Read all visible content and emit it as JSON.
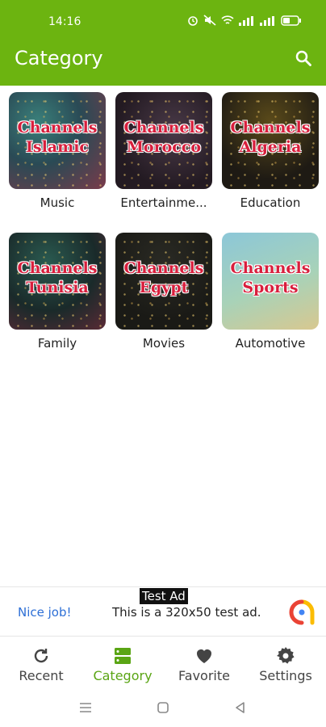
{
  "status_bar": {
    "time": "14:16"
  },
  "app_bar": {
    "title": "Category"
  },
  "categories": [
    {
      "label": "Music",
      "thumb_text_1": "Channels",
      "thumb_text_2": "Islamic"
    },
    {
      "label": "Entertainme...",
      "thumb_text_1": "Channels",
      "thumb_text_2": "Morocco"
    },
    {
      "label": "Education",
      "thumb_text_1": "Channels",
      "thumb_text_2": "Algeria"
    },
    {
      "label": "Family",
      "thumb_text_1": "Channels",
      "thumb_text_2": "Tunisia"
    },
    {
      "label": "Movies",
      "thumb_text_1": "Channels",
      "thumb_text_2": "Egypt"
    },
    {
      "label": "Automotive",
      "thumb_text_1": "Channels",
      "thumb_text_2": "Sports"
    }
  ],
  "ad": {
    "tag": "Test Ad",
    "cta": "Nice job!",
    "description": "This is a 320x50 test ad."
  },
  "bottom_nav": [
    {
      "label": "Recent",
      "icon": "refresh-icon"
    },
    {
      "label": "Category",
      "icon": "category-icon",
      "active": true
    },
    {
      "label": "Favorite",
      "icon": "heart-icon"
    },
    {
      "label": "Settings",
      "icon": "gear-icon"
    }
  ],
  "colors": {
    "primary": "#6cb410",
    "active_nav": "#5aa514",
    "thumb_text": "#d81e3c",
    "ad_cta": "#2d6fd6"
  }
}
